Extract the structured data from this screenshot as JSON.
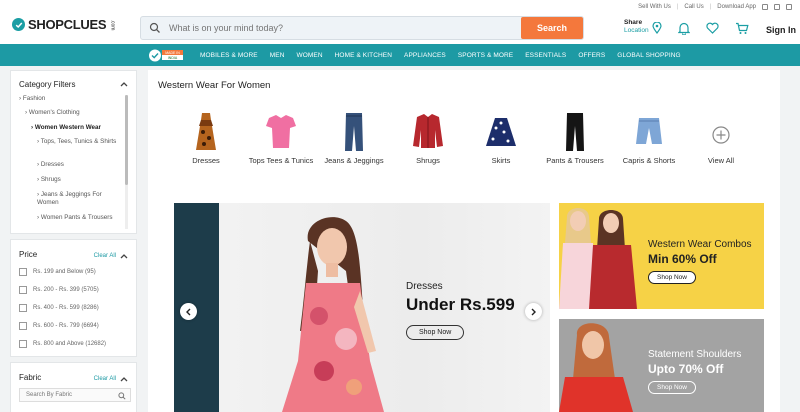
{
  "brand": {
    "name": "SHOPCLUES",
    "suffix": ".com",
    "color": "#1b9ea4"
  },
  "utility_links": [
    "Sell With Us",
    "Call Us",
    "Download App"
  ],
  "search": {
    "placeholder": "What is on your mind today?",
    "button": "Search"
  },
  "header": {
    "share_label": "Share",
    "location_label": "Location",
    "sign_in": "Sign In",
    "icons": [
      "location-pin-icon",
      "bell-icon",
      "heart-icon",
      "cart-icon"
    ]
  },
  "nav": {
    "badge": "MADE IN INDIA",
    "items": [
      "MOBILES & MORE",
      "MEN",
      "WOMEN",
      "HOME & KITCHEN",
      "APPLIANCES",
      "SPORTS & MORE",
      "ESSENTIALS",
      "OFFERS",
      "GLOBAL SHOPPING"
    ],
    "color": "#1d9aa4"
  },
  "sidebar": {
    "category_title": "Category Filters",
    "tree": [
      "Fashion",
      "Women's Clothing",
      "Women Western Wear",
      "Tops, Tees, Tunics & Shirts",
      "Dresses",
      "Shrugs",
      "Jeans & Jeggings For Women",
      "Women Pants & Trousers"
    ],
    "price": {
      "title": "Price",
      "clear": "Clear All",
      "options": [
        "Rs. 199 and Below (95)",
        "Rs. 200 - Rs. 399 (5705)",
        "Rs. 400 - Rs. 599 (8286)",
        "Rs. 600 - Rs. 799 (6694)",
        "Rs. 800 and Above (12682)"
      ]
    },
    "fabric": {
      "title": "Fabric",
      "clear": "Clear All",
      "placeholder": "Search By Fabric"
    }
  },
  "main": {
    "title": "Western Wear For Women",
    "categories": [
      "Dresses",
      "Tops Tees & Tunics",
      "Jeans & Jeggings",
      "Shrugs",
      "Skirts",
      "Pants & Trousers",
      "Capris & Shorts",
      "View All"
    ],
    "banner": {
      "category": "Dresses",
      "deal": "Under Rs.599",
      "cta": "Shop Now"
    },
    "promo1": {
      "title": "Western Wear Combos",
      "offer": "Min 60% Off",
      "cta": "Shop Now",
      "color": "#f6d246"
    },
    "promo2": {
      "title": "Statement Shoulders",
      "offer": "Upto 70% Off",
      "cta": "Shop Now"
    }
  }
}
